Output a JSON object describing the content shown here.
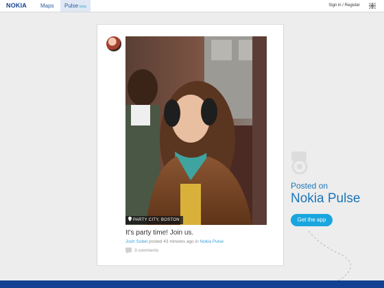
{
  "nav": {
    "logo": "NOKIA",
    "maps": "Maps",
    "pulse": "Pulse",
    "pulse_badge": "beta",
    "signin": "Sign in / Register",
    "flag_icon": "uk-flag-icon"
  },
  "post": {
    "avatar_icon": "user-avatar",
    "location_tag": "PARTY CITY, BOSTON",
    "location_icon": "pin-icon",
    "text": "It's party time! Join us.",
    "author": "Josh Sobel",
    "meta_middle": " posted 43 minutes ago in ",
    "channel": "Nokia Pulse",
    "comments": "3 comments",
    "comment_icon": "speech-bubble-icon"
  },
  "promo": {
    "icon": "pulse-logo-icon",
    "line1": "Posted on",
    "line2": "Nokia Pulse",
    "cta": "Get the app"
  },
  "colors": {
    "brand_blue": "#124191",
    "link_blue": "#3aa0d8",
    "cta_blue": "#19a6df",
    "promo_text": "#1a75b8",
    "background": "#ededed"
  }
}
